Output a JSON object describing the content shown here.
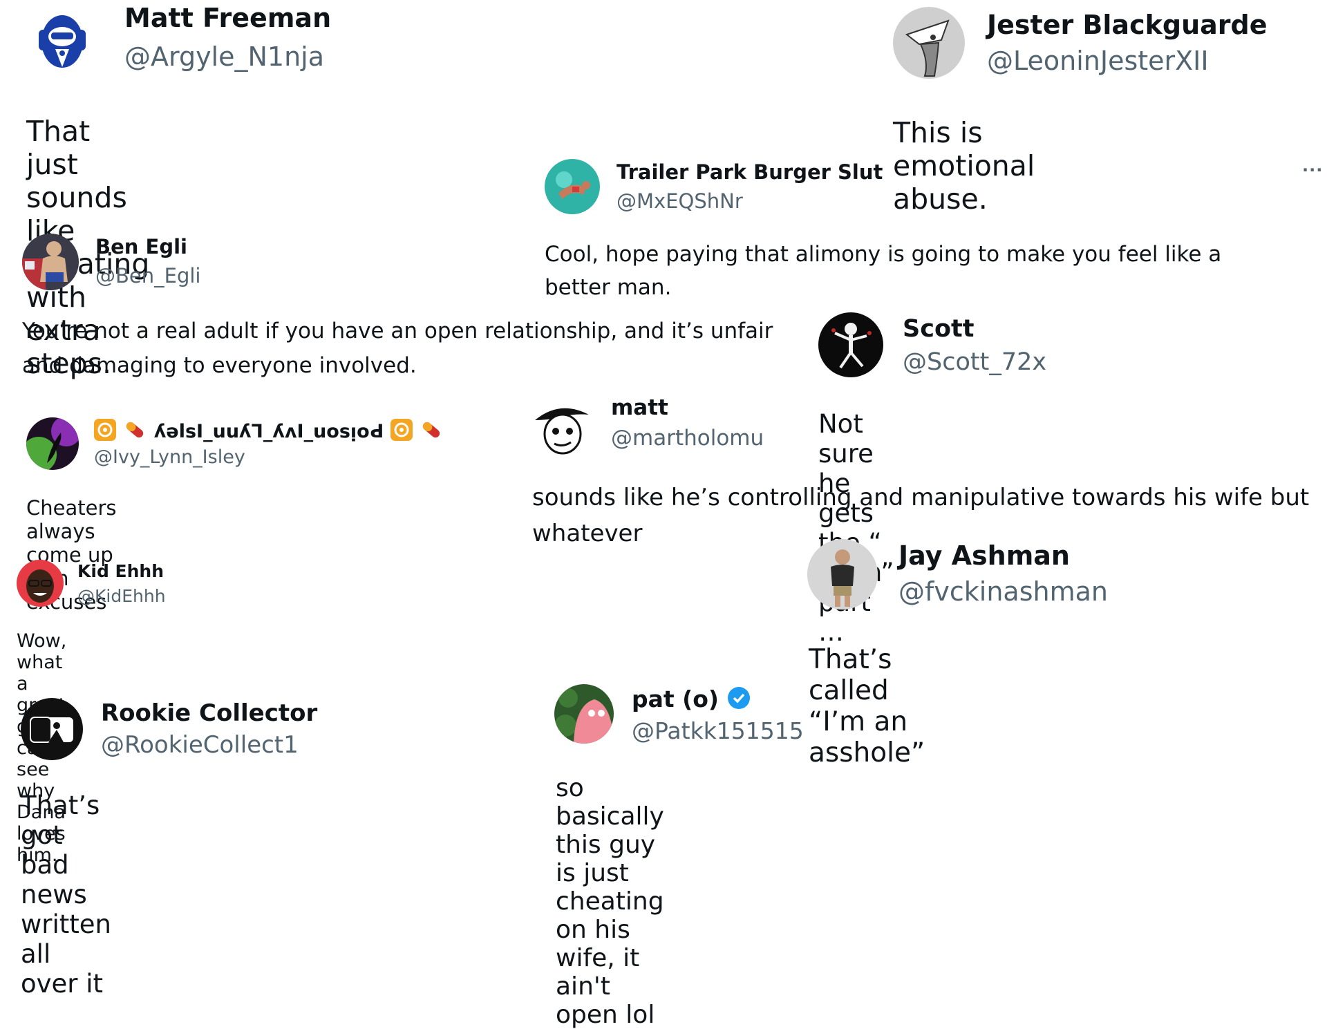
{
  "replies": [
    {
      "name": "Matt Freeman",
      "handle": "@Argyle_N1nja",
      "text": "That just sounds like cheating with extra steps."
    },
    {
      "name": "Jester Blackguarde",
      "handle": "@LeoninJesterXII",
      "text": "This is emotional abuse."
    },
    {
      "name": "Trailer Park Burger Slut",
      "handle": "@MxEQShNr",
      "text": "Cool, hope paying that alimony is going to make you feel like a better man."
    },
    {
      "name": "Ben Egli",
      "handle": "@Ben_Egli",
      "text": "You’re not a real adult if you have an open relationship, and it’s unfair and damaging to everyone involved."
    },
    {
      "name": "Scott",
      "handle": "@Scott_72x",
      "text": "Not sure he gets the “ open” part …"
    },
    {
      "name": "ʎǝlsI_uuʎꞀ_ʎʌI_uosᴉoԀ",
      "handle": "@Ivy_Lynn_Isley",
      "text": "Cheaters always come up with excuses"
    },
    {
      "name": "matt",
      "handle": "@martholomu",
      "text": "sounds like he’s controlling and manipulative towards his wife but whatever"
    },
    {
      "name": "Kid Ehhh",
      "handle": "@KidEhhh",
      "text": "Wow, what a great guy. I can see why Dana loves him."
    },
    {
      "name": "Jay Ashman",
      "handle": "@fvckinashman",
      "text": "That’s called “I’m an asshole”"
    },
    {
      "name": "Rookie Collector",
      "handle": "@RookieCollect1",
      "text": "That’s got bad news written all over it"
    },
    {
      "name": "pat (o)",
      "handle": "@Patkk151515",
      "text": "so basically this guy is just cheating on his wife, it ain't open lol"
    }
  ],
  "more_label": "···",
  "icons": {
    "more": "more-horizontal-icon",
    "verified": "verified-badge-icon",
    "biohazard": "biohazard-icon",
    "pill": "pill-icon"
  },
  "colors": {
    "name": "#0f1419",
    "handle": "#536471",
    "verified": "#1d9bf0",
    "biohazard": "#f4a522",
    "pill": "#d0312d"
  }
}
